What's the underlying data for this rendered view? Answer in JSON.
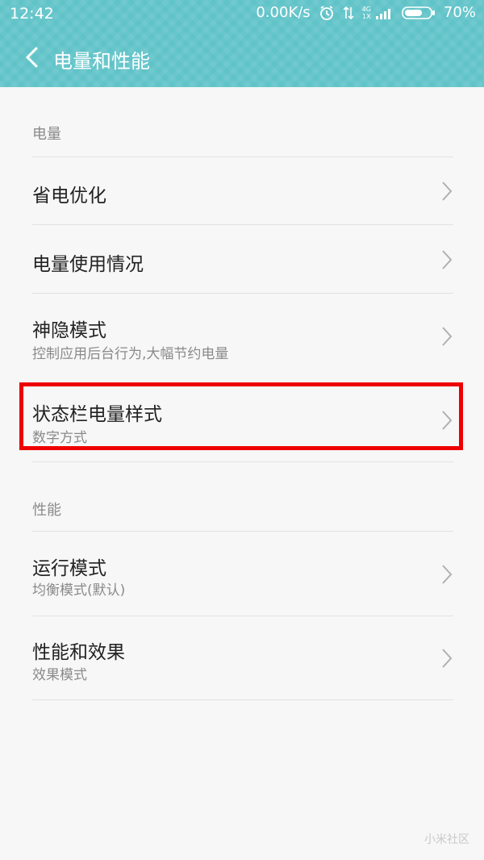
{
  "status_bar": {
    "time": "12:42",
    "network_speed": "0.00K/s",
    "network_type_top": "4G",
    "network_type_bottom": "1X",
    "battery": "70%",
    "battery_level": 0.7,
    "icons": [
      "alarm-icon",
      "data-arrows-icon",
      "signal-icon",
      "battery-icon"
    ]
  },
  "header": {
    "title": "电量和性能",
    "back_icon": "chevron-left-icon",
    "background_color": "#5fc3c8"
  },
  "sections": [
    {
      "header": "电量",
      "items": [
        {
          "title": "省电优化",
          "subtitle": ""
        },
        {
          "title": "电量使用情况",
          "subtitle": ""
        },
        {
          "title": "神隐模式",
          "subtitle": "控制应用后台行为,大幅节约电量"
        },
        {
          "title": "状态栏电量样式",
          "subtitle": "数字方式",
          "highlighted": true
        }
      ]
    },
    {
      "header": "性能",
      "items": [
        {
          "title": "运行模式",
          "subtitle": "均衡模式(默认)"
        },
        {
          "title": "性能和效果",
          "subtitle": "效果模式"
        }
      ]
    }
  ],
  "highlight_color": "#ee0000",
  "watermark": "小米社区"
}
